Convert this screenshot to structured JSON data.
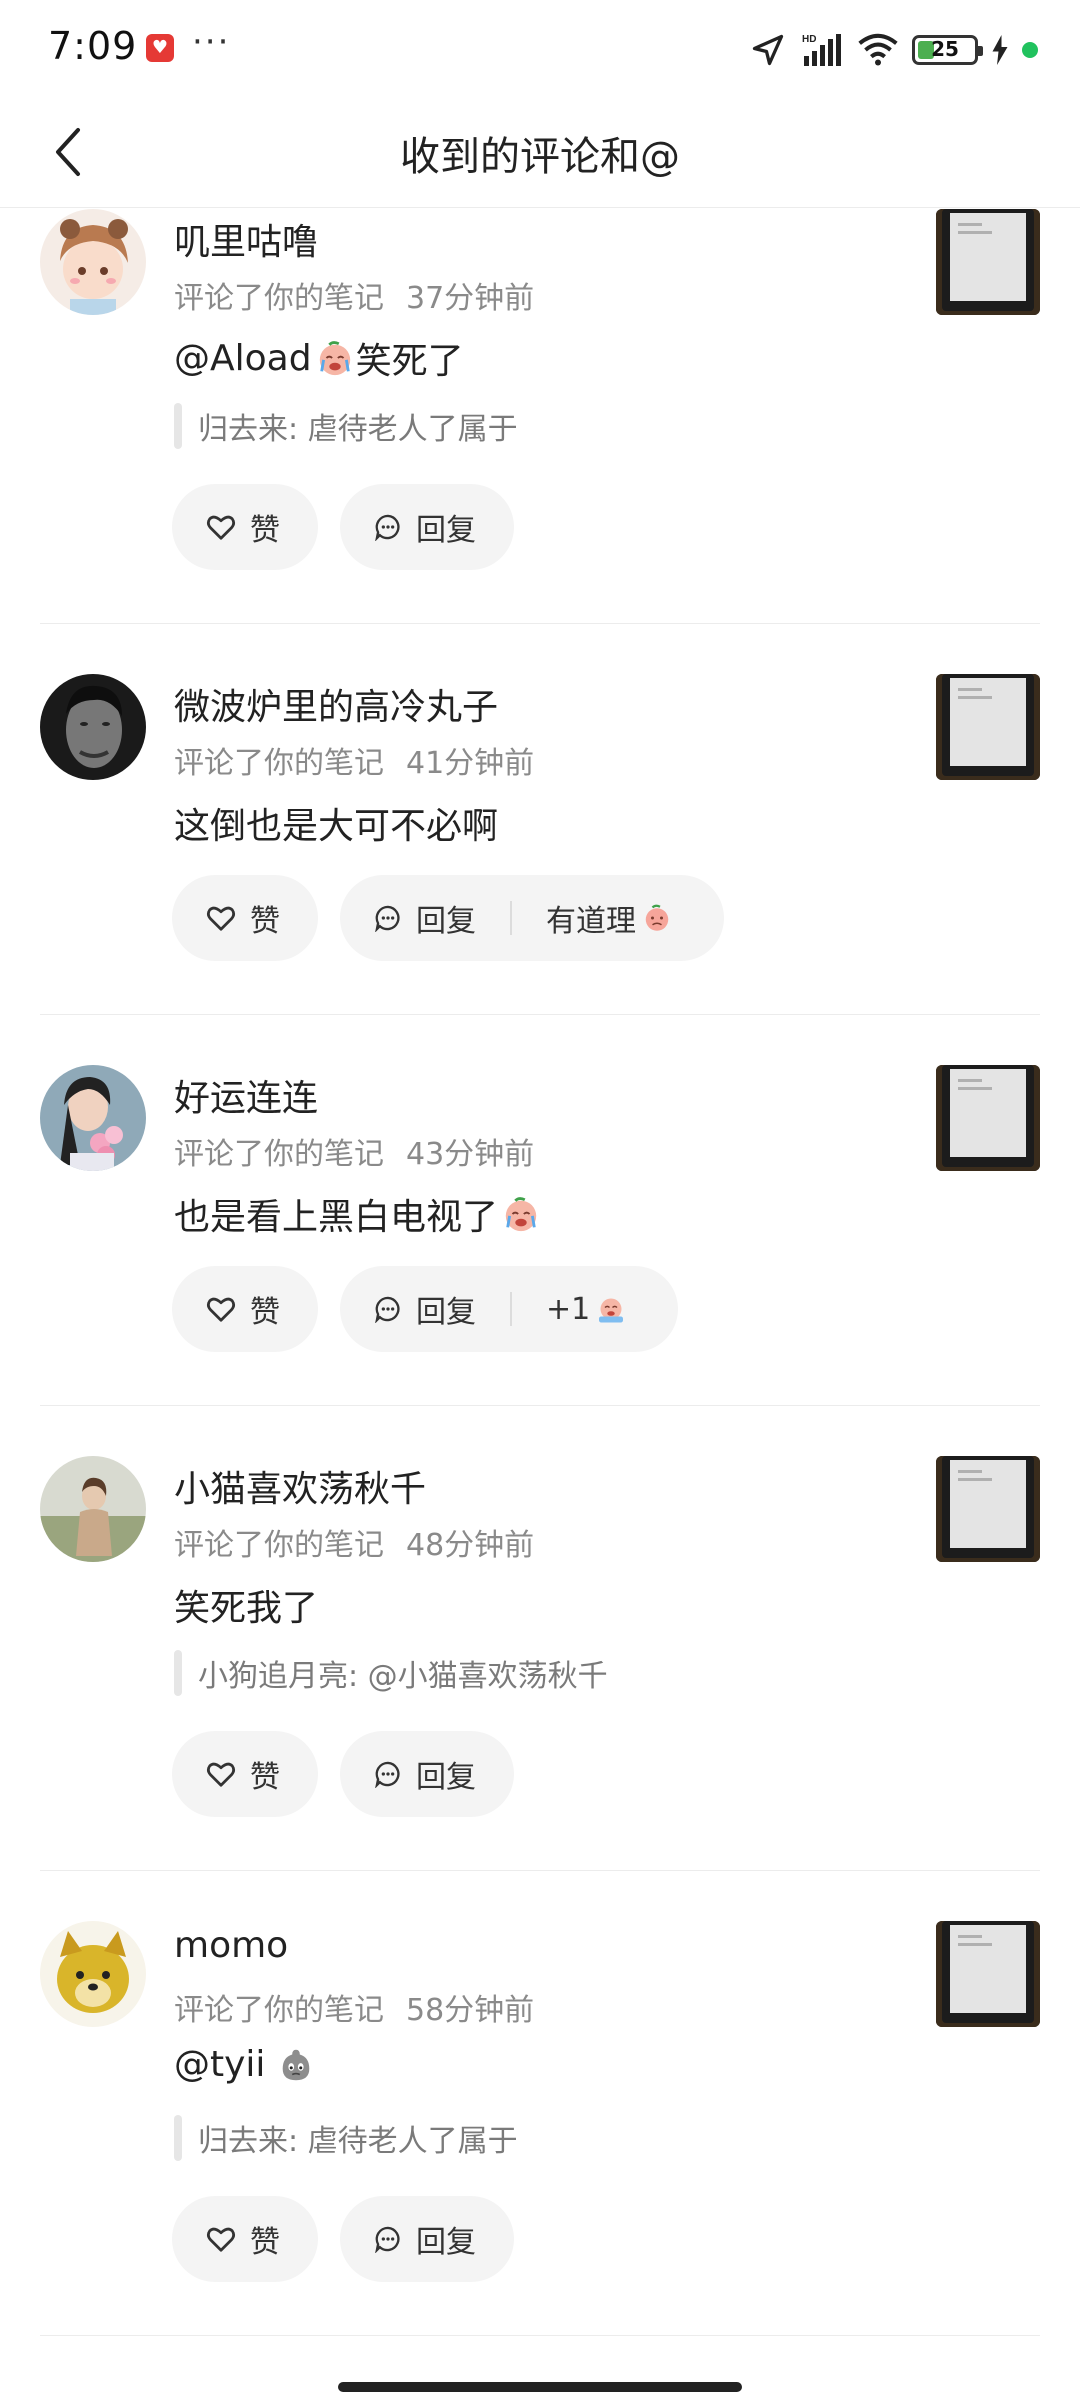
{
  "status_bar": {
    "time": "7:09",
    "battery": "25",
    "more": "···"
  },
  "header": {
    "title": "收到的评论和@"
  },
  "items": [
    {
      "username": "叽里咕噜",
      "action": "评论了你的笔记",
      "time": "37分钟前",
      "comment": "@Aload",
      "comment_suffix": "笑死了",
      "emoji": "crying-emoji",
      "quote": "归去来: 虐待老人了属于",
      "like_label": "赞",
      "reply_label": "回复"
    },
    {
      "username": "微波炉里的高冷丸子",
      "action": "评论了你的笔记",
      "time": "41分钟前",
      "comment": "这倒也是大可不必啊",
      "like_label": "赞",
      "reply_label": "回复",
      "quick_reply": "有道理",
      "quick_reply_emoji": "embarrassed-emoji"
    },
    {
      "username": "好运连连",
      "action": "评论了你的笔记",
      "time": "43分钟前",
      "comment": "也是看上黑白电视了",
      "emoji": "crying-emoji",
      "like_label": "赞",
      "reply_label": "回复",
      "quick_reply": "+1",
      "quick_reply_emoji": "crying-emoji"
    },
    {
      "username": "小猫喜欢荡秋千",
      "action": "评论了你的笔记",
      "time": "48分钟前",
      "comment": "笑死我了",
      "quote": "小狗追月亮: @小猫喜欢荡秋千",
      "like_label": "赞",
      "reply_label": "回复"
    },
    {
      "username": "momo",
      "action": "评论了你的笔记",
      "time": "58分钟前",
      "comment": "@tyii",
      "emoji": "gray-blob-emoji",
      "quote": "归去来: 虐待老人了属于",
      "like_label": "赞",
      "reply_label": "回复"
    }
  ],
  "colors": {
    "background": "#ffffff",
    "pill_background": "#f4f4f4",
    "meta_text": "#8a8a8a",
    "divider": "#ececec",
    "status_green": "#21c25e"
  }
}
